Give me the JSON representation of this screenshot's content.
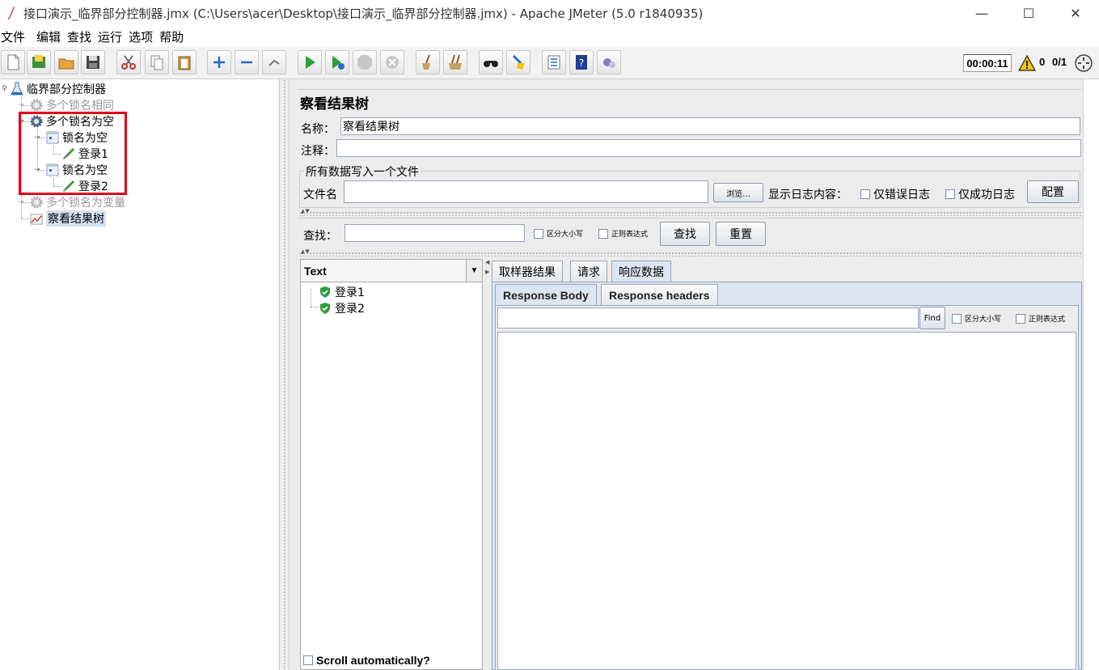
{
  "window": {
    "title": "接口演示_临界部分控制器.jmx (C:\\Users\\acer\\Desktop\\接口演示_临界部分控制器.jmx) - Apache JMeter (5.0 r1840935)",
    "minimize": "—",
    "maximize": "☐",
    "close": "✕"
  },
  "menu": [
    "文件",
    "编辑",
    "查找",
    "运行",
    "选项",
    "帮助"
  ],
  "toolbar": {
    "buttons": [
      "new-icon",
      "templates-icon",
      "open-icon",
      "save-icon",
      "cut-icon",
      "copy-icon",
      "paste-icon",
      "expand-icon",
      "collapse-icon",
      "toggle-icon",
      "start-icon",
      "start-no-pause-icon",
      "stop-icon",
      "shutdown-icon",
      "clear-icon",
      "clear-all-icon",
      "search-icon",
      "reset-search-icon",
      "function-helper-icon",
      "help-icon",
      "remote-icon"
    ],
    "timer": "00:00:11",
    "warnings": "0",
    "threads": "0/1"
  },
  "tree": {
    "root": "临界部分控制器",
    "items": [
      {
        "label": "多个锁名相同",
        "disabled": true
      },
      {
        "label": "多个锁名为空",
        "disabled": false
      },
      {
        "label": "锁名为空",
        "disabled": false
      },
      {
        "label": "登录1",
        "disabled": false
      },
      {
        "label": "锁名为空",
        "disabled": false
      },
      {
        "label": "登录2",
        "disabled": false
      },
      {
        "label": "多个锁名为变量",
        "disabled": true
      },
      {
        "label": "察看结果树",
        "disabled": false,
        "selected": true
      }
    ]
  },
  "panel": {
    "title": "察看结果树",
    "name_label": "名称：",
    "name_value": "察看结果树",
    "comment_label": "注释：",
    "comment_value": "",
    "file_group_title": "所有数据写入一个文件",
    "filename_label": "文件名",
    "filename_value": "",
    "browse": "浏览...",
    "log_label": "显示日志内容：",
    "errors_only": "仅错误日志",
    "success_only": "仅成功日志",
    "configure": "配置"
  },
  "search": {
    "label": "查找：",
    "value": "",
    "case_sensitive": "区分大小写",
    "regex": "正则表达式",
    "find_button": "查找",
    "reset_button": "重置"
  },
  "results": {
    "renderer": "Text",
    "samples": [
      "登录1",
      "登录2"
    ],
    "scroll_auto": "Scroll automatically?",
    "tabs": [
      "取样器结果",
      "请求",
      "响应数据"
    ],
    "active_tab": "响应数据",
    "subtabs": [
      "Response Body",
      "Response headers"
    ],
    "find_button": "Find",
    "case_sensitive": "区分大小写",
    "regex": "正则表达式"
  },
  "colors": {
    "highlight_box": "#e3001b",
    "selection": "#d4e2f4",
    "success": "#2e9e3a"
  }
}
